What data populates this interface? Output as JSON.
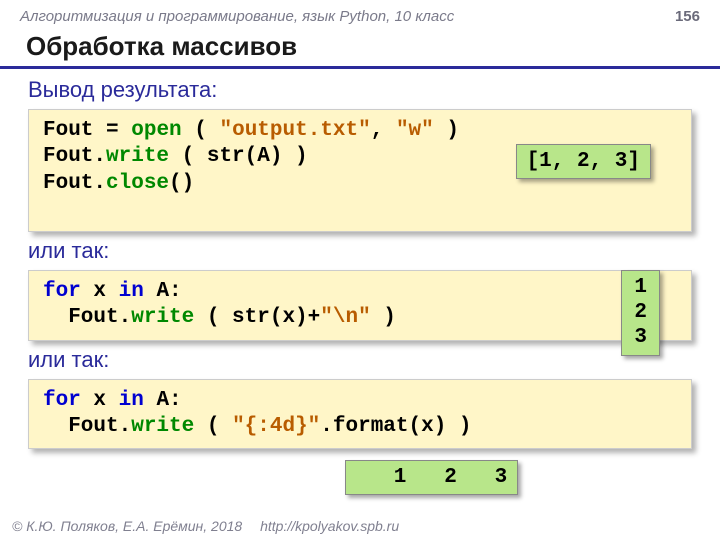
{
  "header": {
    "course": "Алгоритмизация и программирование, язык Python, 10 класс",
    "page": "156"
  },
  "title": "Обработка массивов",
  "sections": {
    "s1_label": "Вывод результата:",
    "s2_label": "или так:",
    "s3_label": "или так:"
  },
  "code1": {
    "l1a": "Fout",
    "l1b": "=",
    "l1c": "open",
    "l1d": "(",
    "l1e": "\"output.txt\"",
    "l1f": ", ",
    "l1g": "\"w\"",
    "l1h": " )",
    "l2a": "Fout.",
    "l2b": "write",
    "l2c": "( str(A) )",
    "l3a": "Fout.",
    "l3b": "close",
    "l3c": "()"
  },
  "out1": "[1, 2, 3]",
  "code2": {
    "l1a": "for",
    "l1b": " x ",
    "l1c": "in",
    "l1d": " A:",
    "l2a": "  Fout.",
    "l2b": "write",
    "l2c": "( str(x)+",
    "l2d": "\"\\n\"",
    "l2e": " )"
  },
  "out2": "1\n2\n3",
  "code3": {
    "l1a": "for",
    "l1b": " x ",
    "l1c": "in",
    "l1d": " A:",
    "l2a": "  Fout.",
    "l2b": "write",
    "l2c": "( ",
    "l2d": "\"{:4d}\"",
    "l2e": ".format(x) )"
  },
  "out3": "   1   2   3",
  "footer": {
    "copyright": "© К.Ю. Поляков, Е.А. Ерёмин, 2018",
    "url": "http://kpolyakov.spb.ru"
  }
}
